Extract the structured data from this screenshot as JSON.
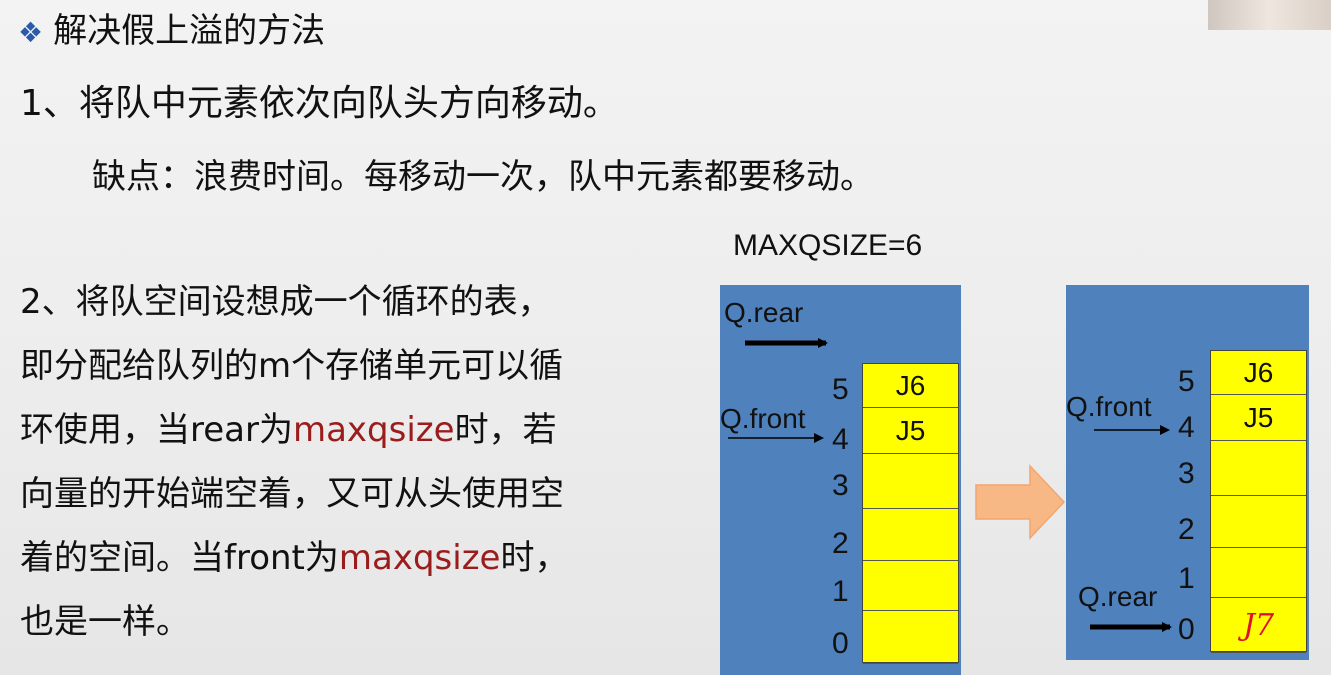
{
  "heading": {
    "bullet": "❖",
    "text": "解决假上溢的方法"
  },
  "point1": "1、将队中元素依次向队头方向移动。",
  "drawback": "缺点：浪费时间。每移动一次，队中元素都要移动。",
  "point2": {
    "lines": [
      [
        {
          "t": " 2、将队空间设想成一个循环的表，"
        }
      ],
      [
        {
          "t": "即分配给队列的m个存储单元可以循"
        }
      ],
      [
        {
          "t": "环使用，当rear为"
        },
        {
          "t": "maxqsize",
          "red": true
        },
        {
          "t": "时，若"
        }
      ],
      [
        {
          "t": "向量的开始端空着，又可从头使用空"
        }
      ],
      [
        {
          "t": "着的空间。当front为"
        },
        {
          "t": "maxqsize",
          "red": true
        },
        {
          "t": "时，"
        }
      ],
      [
        {
          "t": "也是一样。"
        }
      ]
    ]
  },
  "diagram": {
    "maxqsize_label": "MAXQSIZE=6",
    "left": {
      "rear_label": "Q.rear",
      "front_label": "Q.front",
      "indices": [
        "5",
        "4",
        "3",
        "2",
        "1",
        "0"
      ],
      "cells": [
        "J6",
        "J5",
        "",
        "",
        "",
        ""
      ]
    },
    "right": {
      "front_label": "Q.front",
      "rear_label": "Q.rear",
      "indices": [
        "5",
        "4",
        "3",
        "2",
        "1",
        "0"
      ],
      "cells": [
        "J6",
        "J5",
        "",
        "",
        "",
        ""
      ],
      "handwritten": "J7"
    },
    "colors": {
      "panel": "#4f81bd",
      "cell": "#ffff00",
      "highlight": "#9b1c1c",
      "transition_arrow": "#f8b886",
      "handwriting": "#e0102a"
    }
  }
}
